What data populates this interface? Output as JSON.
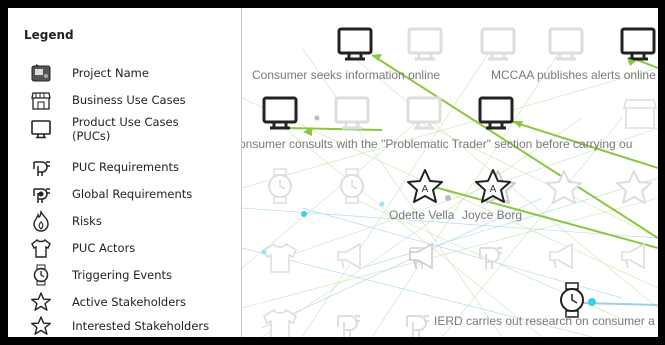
{
  "legend": {
    "title": "Legend",
    "items": [
      {
        "icon": "project-name-icon",
        "label": "Project Name"
      },
      {
        "icon": "business-use-cases-icon",
        "label": "Business Use Cases"
      },
      {
        "icon": "product-use-cases-icon",
        "label": "Product Use Cases (PUCs)"
      },
      {
        "icon": "puc-requirements-icon",
        "label": "PUC Requirements"
      },
      {
        "icon": "global-requirements-icon",
        "label": "Global Requirements"
      },
      {
        "icon": "risks-icon",
        "label": "Risks"
      },
      {
        "icon": "puc-actors-icon",
        "label": "PUC Actors"
      },
      {
        "icon": "triggering-events-icon",
        "label": "Triggering Events"
      },
      {
        "icon": "active-stakeholders-icon",
        "label": "Active Stakeholders"
      },
      {
        "icon": "interested-stakeholders-icon",
        "label": "Interested Stakeholders"
      }
    ]
  },
  "graph": {
    "labels": {
      "consumer_seeks": "Consumer seeks information online",
      "mccaa_publishes": "MCCAA publishes alerts online",
      "consumer_consults_dim": "Consumer consults with the",
      "problematic_trader": "onsumer consults with the \"Problematic Trader\" section before carrying ou",
      "odette": "Odette Vella",
      "joyce": "Joyce Borg",
      "ierd": "IERD carries out research on consumer a"
    },
    "stakeholder_badge": "A",
    "colors": {
      "edge_green": "#8cc63f",
      "edge_faint_green": "#cde8a8",
      "edge_blue": "#9ccfe8",
      "node_cyan": "#35d0ea",
      "node_dark": "#222222",
      "node_faint": "#d8d8d8"
    }
  }
}
